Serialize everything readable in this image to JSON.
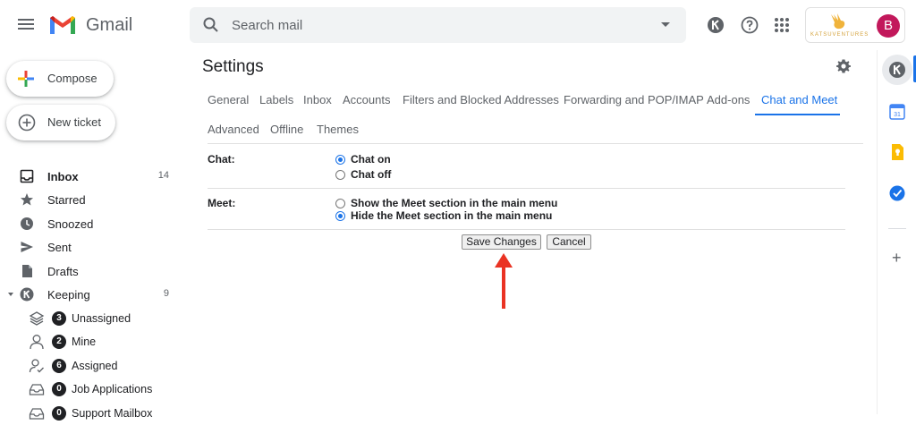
{
  "app": {
    "name": "Gmail"
  },
  "header": {
    "search_placeholder": "Search mail",
    "brand_name": "KATSUVENTURES",
    "avatar_initial": "B",
    "icons": [
      "menu-icon",
      "gmail-logo",
      "search-icon",
      "search-options-icon",
      "keeping-icon",
      "help-icon",
      "apps-icon"
    ]
  },
  "sidebar": {
    "compose_label": "Compose",
    "new_ticket_label": "New ticket",
    "items": [
      {
        "label": "Inbox",
        "count": "14",
        "icon": "inbox-icon"
      },
      {
        "label": "Starred",
        "count": "",
        "icon": "star-icon"
      },
      {
        "label": "Snoozed",
        "count": "",
        "icon": "clock-icon"
      },
      {
        "label": "Sent",
        "count": "",
        "icon": "send-icon"
      },
      {
        "label": "Drafts",
        "count": "",
        "icon": "draft-icon"
      },
      {
        "label": "Keeping",
        "count": "9",
        "icon": "keeping-icon"
      }
    ],
    "keeping_items": [
      {
        "label": "Unassigned",
        "badge": "3",
        "icon": "layers-icon"
      },
      {
        "label": "Mine",
        "badge": "2",
        "icon": "person-icon"
      },
      {
        "label": "Assigned",
        "badge": "6",
        "icon": "person-check-icon"
      },
      {
        "label": "Job Applications",
        "badge": "0",
        "icon": "tray-icon"
      },
      {
        "label": "Support Mailbox",
        "badge": "0",
        "icon": "tray-icon"
      }
    ]
  },
  "settings": {
    "title": "Settings",
    "tabs_row1": [
      "General",
      "Labels",
      "Inbox",
      "Accounts",
      "Filters and Blocked Addresses",
      "Forwarding and POP/IMAP",
      "Add-ons",
      "Chat and Meet"
    ],
    "tabs_row2": [
      "Advanced",
      "Offline",
      "Themes"
    ],
    "active_tab": "Chat and Meet",
    "chat": {
      "label": "Chat:",
      "options": [
        {
          "label": "Chat on",
          "checked": true
        },
        {
          "label": "Chat off",
          "checked": false
        }
      ]
    },
    "meet": {
      "label": "Meet:",
      "options": [
        {
          "label": "Show the Meet section in the main menu",
          "checked": false
        },
        {
          "label": "Hide the Meet section in the main menu",
          "checked": true
        }
      ]
    },
    "save_label": "Save Changes",
    "cancel_label": "Cancel"
  },
  "colors": {
    "accent": "#1a73e8",
    "arrow": "#ea3323",
    "avatar": "#c2185b"
  }
}
